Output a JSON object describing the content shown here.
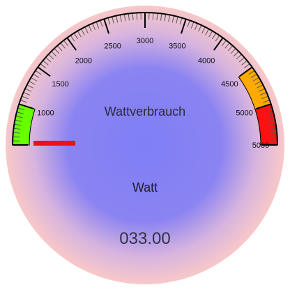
{
  "gauge": {
    "title": "Wattverbrauch",
    "unit": "Watt",
    "value_text": "033.00",
    "value": 33,
    "min": 0,
    "max": 5000,
    "major_ticks": [
      {
        "value": 500,
        "label": "1000"
      },
      {
        "value": 1000,
        "label": "1500"
      },
      {
        "value": 1500,
        "label": "2000"
      },
      {
        "value": 2000,
        "label": "2500"
      },
      {
        "value": 2500,
        "label": "3000"
      },
      {
        "value": 3000,
        "label": "3500"
      },
      {
        "value": 3500,
        "label": "4000"
      },
      {
        "value": 4000,
        "label": "4500"
      },
      {
        "value": 4500,
        "label": "5000"
      },
      {
        "value": 5000,
        "label": "5000"
      }
    ],
    "zones": [
      {
        "from": 0,
        "to": 500,
        "color": "#66ff00"
      },
      {
        "from": 4000,
        "to": 4500,
        "color": "#ffaa00"
      },
      {
        "from": 4500,
        "to": 5000,
        "color": "#ff1111"
      }
    ],
    "colors": {
      "outer_glow": "#f8c6c6",
      "center": "#8a7df2",
      "needle": "#ee1111",
      "tick": "#000000"
    }
  }
}
